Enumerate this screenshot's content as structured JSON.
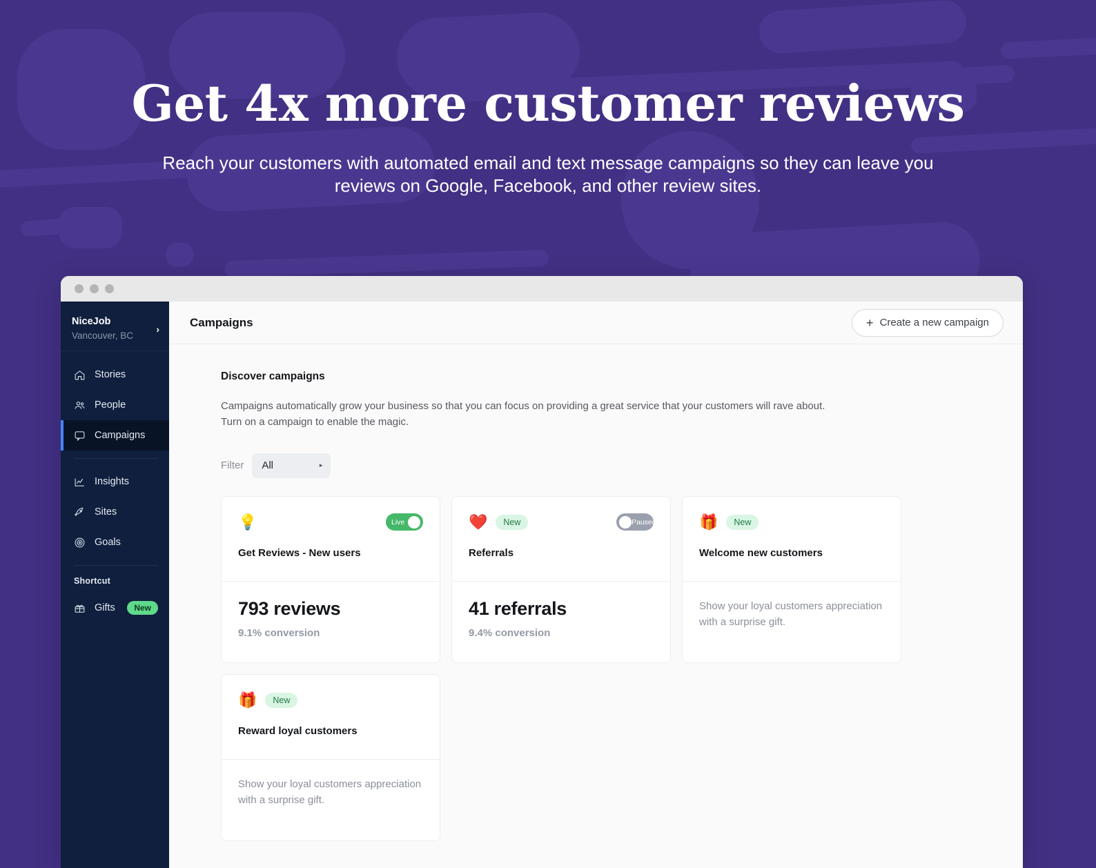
{
  "hero": {
    "title": "Get 4x more customer reviews",
    "subtitle": "Reach your customers with automated email and text message campaigns so they can leave you reviews on Google, Facebook, and other review sites."
  },
  "colors": {
    "hero_background": "#423084",
    "hero_blob": "#4a3890",
    "sidebar_background": "#0f1f3d",
    "sidebar_active_background": "#081426",
    "sidebar_active_indicator": "#4285f4",
    "toggle_on": "#46b86a",
    "toggle_off": "#9aa0ae",
    "badge_new_sidebar": "#5fd98a",
    "badge_new_card": "#d9f5e3"
  },
  "window": {
    "traffic_lights": [
      "close-dot",
      "minimize-dot",
      "maximize-dot"
    ]
  },
  "sidebar": {
    "org": {
      "name": "NiceJob",
      "location": "Vancouver, BC",
      "chevron": "›"
    },
    "items": [
      {
        "label": "Stories",
        "icon": "home-icon",
        "active": false
      },
      {
        "label": "People",
        "icon": "people-icon",
        "active": false
      },
      {
        "label": "Campaigns",
        "icon": "message-icon",
        "active": true
      },
      {
        "label": "Insights",
        "icon": "chart-icon",
        "active": false
      },
      {
        "label": "Sites",
        "icon": "rocket-icon",
        "active": false
      },
      {
        "label": "Goals",
        "icon": "target-icon",
        "active": false
      }
    ],
    "shortcut_title": "Shortcut",
    "shortcut_items": [
      {
        "label": "Gifts",
        "icon": "gift-icon",
        "badge": "New"
      }
    ]
  },
  "topbar": {
    "page_title": "Campaigns",
    "create_button": "Create a new campaign",
    "create_button_icon": "plus-icon"
  },
  "discover": {
    "heading": "Discover campaigns",
    "description": "Campaigns automatically grow your business so that you can focus on providing a great service that your customers will rave about. Turn on a campaign to enable the magic.",
    "filter_label": "Filter",
    "filter_value": "All",
    "filter_caret": "▸"
  },
  "cards": [
    {
      "emoji": "💡",
      "emoji_name": "lightbulb-icon",
      "badge": null,
      "toggle": {
        "state": "on",
        "label": "Live"
      },
      "name": "Get Reviews - New users",
      "stat": "793 reviews",
      "stat_sub": "9.1% conversion",
      "description": null
    },
    {
      "emoji": "❤️",
      "emoji_name": "heart-icon",
      "badge": "New",
      "toggle": {
        "state": "off",
        "label": "Paused"
      },
      "name": "Referrals",
      "stat": "41 referrals",
      "stat_sub": "9.4% conversion",
      "description": null
    },
    {
      "emoji": "🎁",
      "emoji_name": "green-gift-icon",
      "badge": "New",
      "toggle": null,
      "name": "Welcome new customers",
      "stat": null,
      "stat_sub": null,
      "description": "Show your loyal customers appreciation with a surprise gift."
    },
    {
      "emoji": "🎁",
      "emoji_name": "blue-gift-icon",
      "badge": "New",
      "toggle": null,
      "name": "Reward loyal customers",
      "stat": null,
      "stat_sub": null,
      "description": "Show your loyal customers appreciation with a surprise gift."
    }
  ]
}
